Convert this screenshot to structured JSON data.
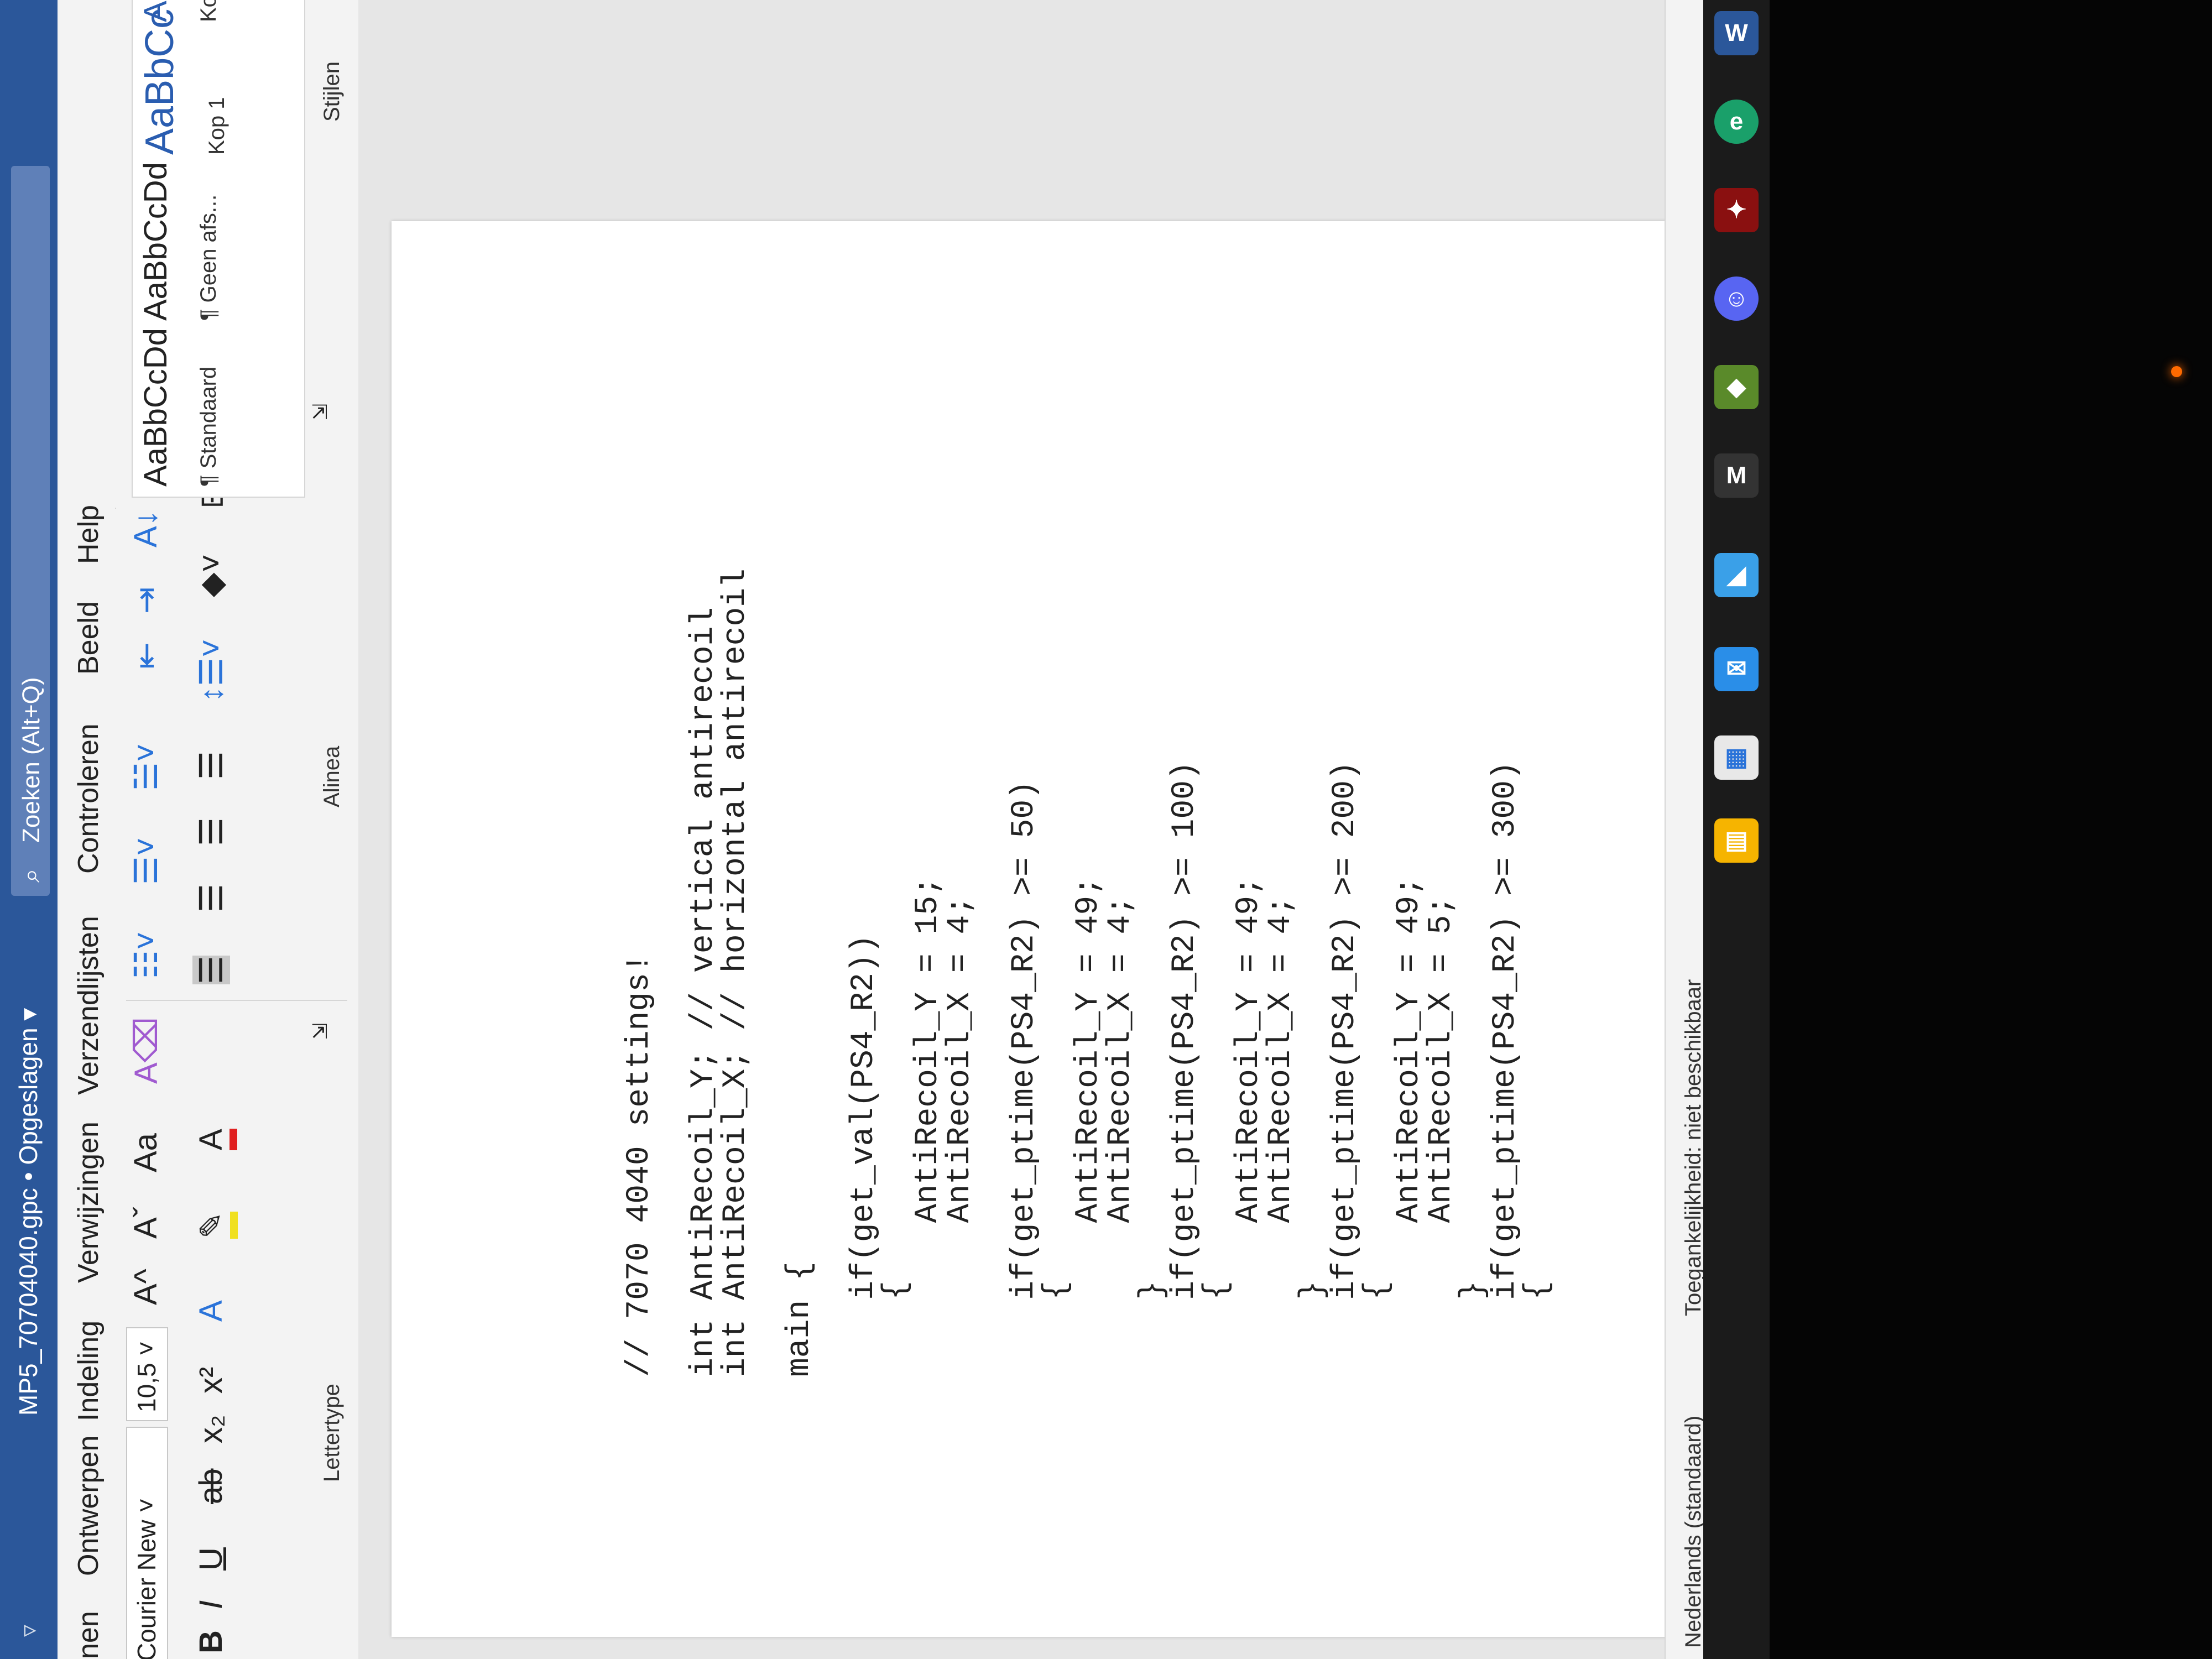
{
  "window": {
    "quick_access": "▿",
    "title": "MP5_70704040.gpc • Opgeslagen ▾",
    "search_placeholder": "Zoeken (Alt+Q)"
  },
  "tabs": [
    "nen",
    "Ontwerpen",
    "Indeling",
    "Verwijzingen",
    "Verzendlijsten",
    "Controleren",
    "Beeld",
    "Help"
  ],
  "ribbon": {
    "font_name": "Courier New",
    "font_size": "10,5",
    "bold": "B",
    "italic": "I",
    "underline": "U",
    "strikethrough": "ab",
    "subscript": "x₂",
    "superscript": "x²",
    "grow_font": "A^",
    "shrink_font": "Aˇ",
    "change_case": "Aa",
    "text_effects": "A",
    "font_color": "A",
    "group_font": "Lettertype",
    "group_paragraph": "Alinea",
    "group_styles": "Stijlen",
    "styles": [
      {
        "preview": "AaBbCcDd",
        "label": "¶ Standaard"
      },
      {
        "preview": "AaBbCcDd",
        "label": "¶ Geen afs..."
      },
      {
        "preview": "AaBbCc",
        "label": "Kop 1"
      },
      {
        "preview": "AaBb",
        "label": "Kop"
      }
    ]
  },
  "document": {
    "lines": [
      "// 7070 4040 settings!",
      "",
      "int AntiRecoil_Y; // vertical antirecoil",
      "int AntiRecoil_X; // horizontal antirecoil",
      "",
      "main {",
      "",
      "    if(get_val(PS4_R2))",
      "    {",
      "        AntiRecoil_Y = 15;",
      "        AntiRecoil_X = 4;",
      "",
      "    if(get_ptime(PS4_R2) >= 50)",
      "    {",
      "        AntiRecoil_Y = 49;",
      "        AntiRecoil_X = 4;",
      "    }",
      "    if(get_ptime(PS4_R2) >= 100)",
      "    {",
      "        AntiRecoil_Y = 49;",
      "        AntiRecoil_X = 4;",
      "    }",
      "    if(get_ptime(PS4_R2) >= 200)",
      "    {",
      "        AntiRecoil_Y = 49;",
      "        AntiRecoil_X = 5;",
      "    }",
      "    if(get_ptime(PS4_R2) >= 300)",
      "    {"
    ]
  },
  "statusbar": {
    "language": "Nederlands (standaard)",
    "accessibility": "Toegankelijkheid: niet beschikbaar"
  }
}
